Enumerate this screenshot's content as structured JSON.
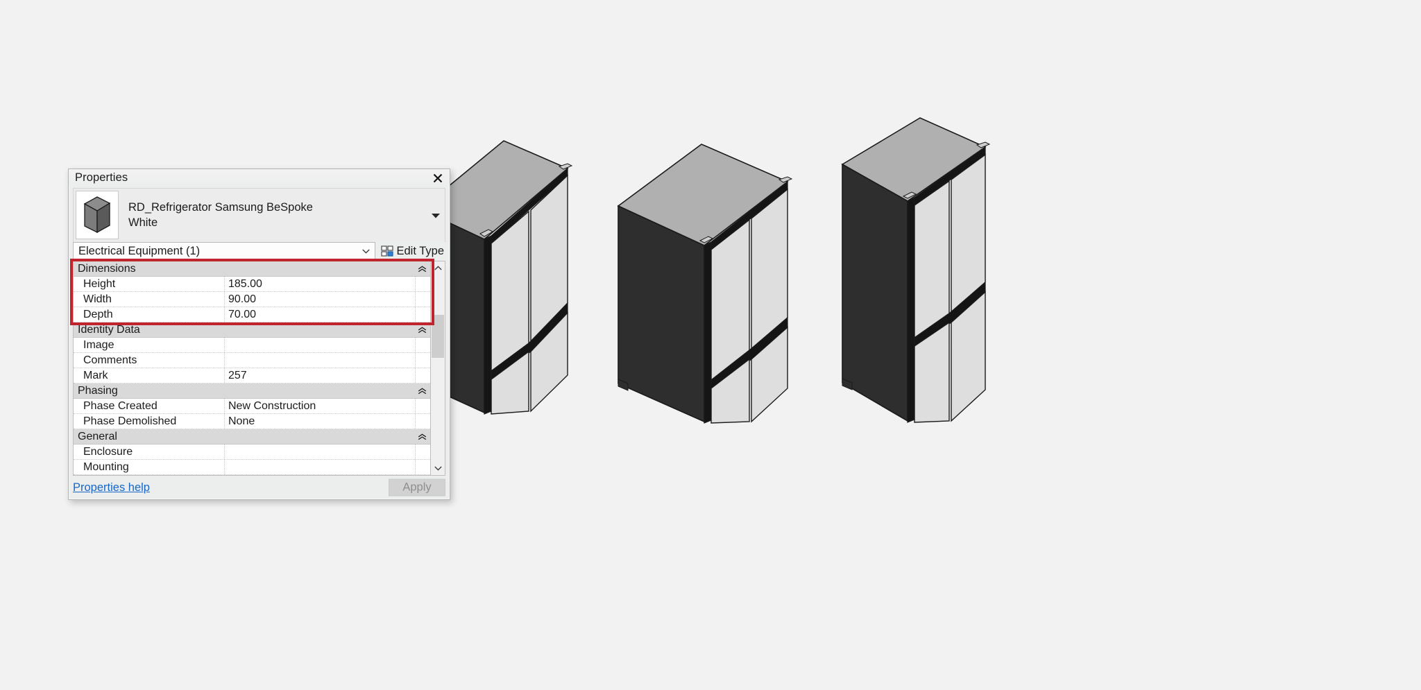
{
  "panel": {
    "title": "Properties",
    "close_icon": "close-icon",
    "type_thumbnail_icon": "box-preview-icon",
    "family_name": "RD_Refrigerator Samsung BeSpoke",
    "type_name": "White",
    "type_dropdown_icon": "chevron-down-icon",
    "category": "Electrical Equipment (1)",
    "category_caret_icon": "chevron-down-icon",
    "edit_type_label": "Edit Type",
    "edit_type_icon": "edit-type-grid-icon",
    "properties_help_label": "Properties help",
    "apply_label": "Apply",
    "scrollbar": {
      "up_icon": "chevron-up-icon",
      "down_icon": "chevron-down-icon"
    },
    "highlight_color": "#c0242c",
    "link_color": "#1668c8",
    "groups": [
      {
        "name": "Dimensions",
        "collapse_icon": "double-chevron-up-icon",
        "rows": [
          {
            "name": "Height",
            "value": "185.00"
          },
          {
            "name": "Width",
            "value": "90.00"
          },
          {
            "name": "Depth",
            "value": "70.00"
          }
        ]
      },
      {
        "name": "Identity Data",
        "collapse_icon": "double-chevron-up-icon",
        "rows": [
          {
            "name": "Image",
            "value": ""
          },
          {
            "name": "Comments",
            "value": ""
          },
          {
            "name": "Mark",
            "value": "257"
          }
        ]
      },
      {
        "name": "Phasing",
        "collapse_icon": "double-chevron-up-icon",
        "rows": [
          {
            "name": "Phase Created",
            "value": "New Construction"
          },
          {
            "name": "Phase Demolished",
            "value": "None"
          }
        ]
      },
      {
        "name": "General",
        "collapse_icon": "double-chevron-up-icon",
        "rows": [
          {
            "name": "Enclosure",
            "value": ""
          },
          {
            "name": "Mounting",
            "value": ""
          }
        ]
      }
    ]
  },
  "viewport": {
    "background_color": "#f2f2f2",
    "model_colors": {
      "top": "#b0b0b0",
      "side_dark": "#2e2e2e",
      "door_light": "#dedede",
      "door_light2": "#d7d7d7",
      "trim_black": "#151515",
      "outline": "#1a1a1a"
    },
    "models": [
      {
        "name": "refrigerator-model-1"
      },
      {
        "name": "refrigerator-model-2"
      },
      {
        "name": "refrigerator-model-3"
      }
    ]
  }
}
